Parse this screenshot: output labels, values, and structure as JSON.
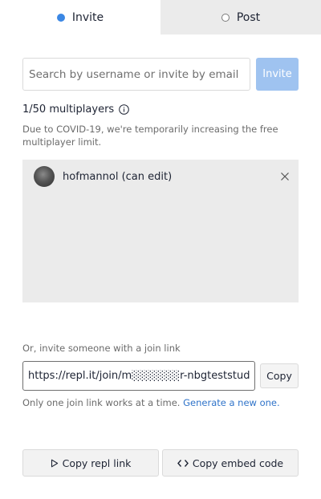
{
  "tabs": [
    {
      "label": "Invite",
      "selected": true
    },
    {
      "label": "Post",
      "selected": false
    }
  ],
  "search": {
    "placeholder": "Search by username or invite by email",
    "value": ""
  },
  "invite_button": "Invite",
  "multiplayers": {
    "count_label": "1/50 multiplayers",
    "note": "Due to COVID-19, we're temporarily increasing the free multiplayer limit."
  },
  "collaborators": [
    {
      "name": "hofmannol (can edit)",
      "avatar": "user-avatar"
    }
  ],
  "join": {
    "label": "Or, invite someone with a join link",
    "link": "https://repl.it/join/m░░░░░░r-nbgteststuden",
    "copy_label": "Copy",
    "note": "Only one join link works at a time.",
    "generate_label": "Generate a new one."
  },
  "buttons": {
    "copy_repl": "Copy repl link",
    "copy_embed": "Copy embed code"
  },
  "icons": {
    "copy_repl": "play-outline-icon",
    "copy_embed": "code-icon",
    "info": "info-icon",
    "remove": "close-icon"
  },
  "colors": {
    "accent": "#3b87e4",
    "button_disabled": "#9fc3f0",
    "link": "#2f73c9",
    "panel": "#ebebeb"
  }
}
